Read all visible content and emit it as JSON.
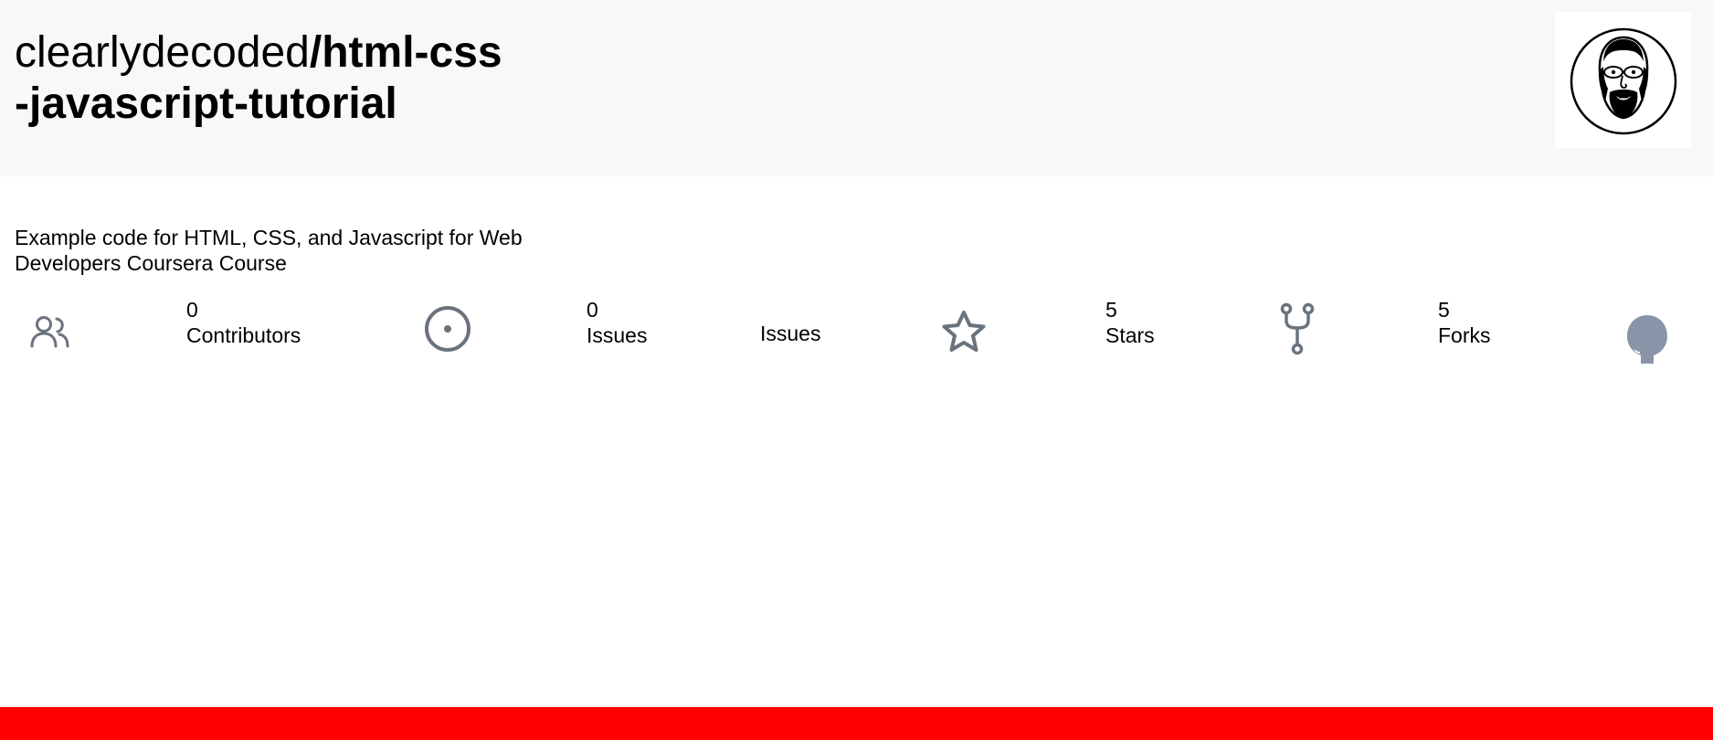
{
  "repo": {
    "owner": "clearlydecoded",
    "slash": "/",
    "name_line1": "html-css",
    "name_line2": "-javascript-tutorial"
  },
  "description": "Example code for HTML, CSS, and Javascript for Web Developers Coursera Course",
  "stats": {
    "contributors": {
      "count": "0",
      "label": "Contributors"
    },
    "issues": {
      "count": "0",
      "label": "Issues"
    },
    "issues_link": {
      "label": "Issues"
    },
    "stars": {
      "count": "5",
      "label": "Stars"
    },
    "forks": {
      "count": "5",
      "label": "Forks"
    }
  },
  "icons": {
    "contributors": "people-icon",
    "issues": "issue-opened-icon",
    "stars": "star-icon",
    "forks": "repo-forked-icon",
    "github": "github-mark-icon"
  },
  "colors": {
    "header_bg": "#f6f8fa",
    "icon_gray": "#6a737d",
    "github_icon": "#8a94a8",
    "footer_bar": "#ff0000"
  }
}
